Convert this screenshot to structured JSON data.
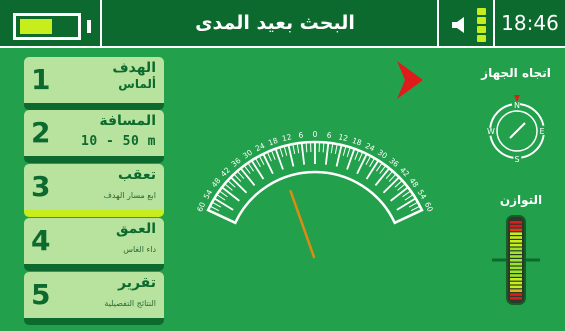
{
  "header": {
    "title": "البحث بعيد المدى",
    "time": "18:46",
    "battery_level": 0.55
  },
  "menu": [
    {
      "number": "1",
      "title": "الهدف",
      "subtitle": "ألماس",
      "active": false
    },
    {
      "number": "2",
      "title": "المسافة",
      "subtitle": "10  -  50  m",
      "active": false
    },
    {
      "number": "3",
      "title": "تعقب",
      "subtitle": "ابع مسار الهدف",
      "active": true
    },
    {
      "number": "4",
      "title": "العمق",
      "subtitle": "داء الغاس",
      "active": false
    },
    {
      "number": "5",
      "title": "تقرير",
      "subtitle": "النتائج التفصيلية",
      "active": false
    }
  ],
  "gauge": {
    "tick_labels": [
      "60",
      "54",
      "48",
      "42",
      "36",
      "30",
      "24",
      "18",
      "12",
      "6",
      "0",
      "6",
      "12",
      "18",
      "24",
      "30",
      "36",
      "42",
      "48",
      "54",
      "60"
    ],
    "needle_value": -18
  },
  "compass": {
    "label": "اتجاه الجهاز",
    "directions": {
      "n": "N",
      "e": "E",
      "s": "S",
      "w": "W"
    }
  },
  "balance": {
    "label": "التوازن"
  },
  "colors": {
    "background": "#22a04b",
    "header": "#0c6a2e",
    "menu_item": "#b8e39e",
    "accent": "#c7ee1c",
    "arrow": "#e01b1b",
    "needle": "#e08a14"
  },
  "icons": {
    "speaker": "speaker-icon",
    "signal": "signal-bars-icon",
    "direction": "direction-arrow-icon"
  }
}
